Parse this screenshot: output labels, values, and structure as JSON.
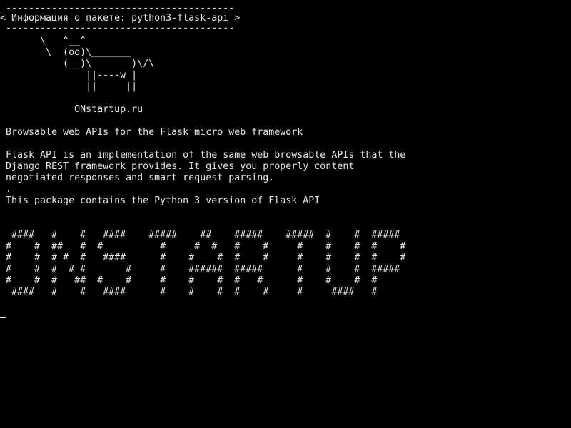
{
  "terminal": {
    "lines": [
      " ----------------------------------------",
      "< Информация о пакете: python3-flask-api >",
      " ----------------------------------------",
      "       \\   ^__^",
      "        \\  (oo)\\_______",
      "           (__)\\       )\\/\\",
      "               ||----w |",
      "               ||     ||",
      "",
      "             ONstartup.ru",
      "",
      " Browsable web APIs for the Flask micro web framework",
      "",
      " Flask API is an implementation of the same web browsable APIs that the",
      " Django REST framework provides. It gives you properly content",
      " negotiated responses and smart request parsing.",
      " .",
      " This package contains the Python 3 version of Flask API",
      "",
      "",
      "  ####   #    #   ####    #####    ##    #####    #####  #    #  #####",
      " #    #  ##   #  #          #     #  #   #    #     #    #    #  #    #",
      " #    #  # #  #   ####      #    #    #  #    #     #    #    #  #    #",
      " #    #  #  # #       #     #    ######  #####      #    #    #  #####",
      " #    #  #   ##  #    #     #    #    #  #   #      #    #    #  #",
      "  ####   #    #   ####      #    #    #  #    #     #     ####   #"
    ]
  }
}
